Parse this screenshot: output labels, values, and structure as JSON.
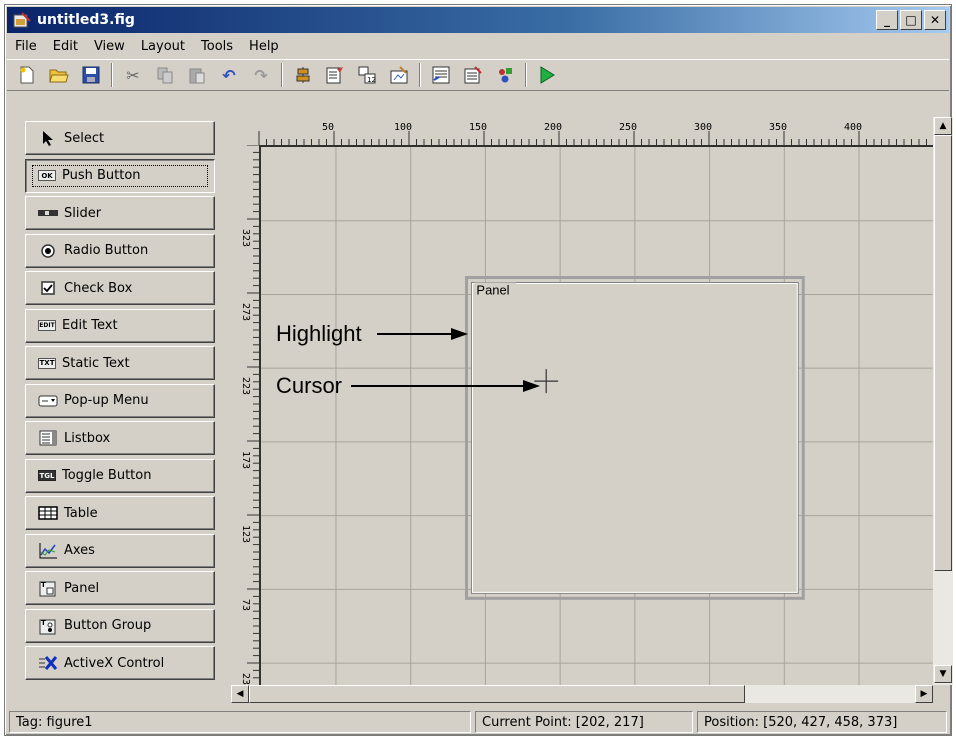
{
  "window": {
    "title": "untitled3.fig"
  },
  "menu": [
    "File",
    "Edit",
    "View",
    "Layout",
    "Tools",
    "Help"
  ],
  "toolbar": {
    "buttons": [
      "new-file-icon",
      "open-folder-icon",
      "save-icon",
      "cut-icon",
      "copy-icon",
      "paste-icon",
      "undo-icon",
      "redo-icon",
      "align-icon",
      "menu-editor-icon",
      "tab-order-icon",
      "toolbar-editor-icon",
      "mfile-editor-icon",
      "property-inspector-icon",
      "object-browser-icon",
      "run-icon"
    ]
  },
  "palette": {
    "items": [
      {
        "label": "Select",
        "icon": "arrow-cursor-icon"
      },
      {
        "label": "Push Button",
        "icon": "push-button-icon",
        "glyph": "OK"
      },
      {
        "label": "Slider",
        "icon": "slider-icon"
      },
      {
        "label": "Radio Button",
        "icon": "radio-button-icon"
      },
      {
        "label": "Check Box",
        "icon": "check-box-icon"
      },
      {
        "label": "Edit Text",
        "icon": "edit-text-icon",
        "glyph": "EDIT"
      },
      {
        "label": "Static Text",
        "icon": "static-text-icon",
        "glyph": "TXT"
      },
      {
        "label": "Pop-up Menu",
        "icon": "popup-menu-icon"
      },
      {
        "label": "Listbox",
        "icon": "listbox-icon"
      },
      {
        "label": "Toggle Button",
        "icon": "toggle-button-icon",
        "glyph": "TGL"
      },
      {
        "label": "Table",
        "icon": "table-icon"
      },
      {
        "label": "Axes",
        "icon": "axes-icon"
      },
      {
        "label": "Panel",
        "icon": "panel-icon"
      },
      {
        "label": "Button Group",
        "icon": "button-group-icon"
      },
      {
        "label": "ActiveX Control",
        "icon": "activex-icon"
      }
    ],
    "selected": "Push Button"
  },
  "rulers": {
    "top_labels": [
      "50",
      "100",
      "150",
      "200",
      "250",
      "300",
      "350",
      "400"
    ],
    "left_labels": [
      "323",
      "273",
      "223",
      "173",
      "123",
      "73",
      "23"
    ]
  },
  "canvas": {
    "panel_title": "Panel",
    "annotations": {
      "highlight": "Highlight",
      "cursor": "Cursor"
    }
  },
  "status": {
    "tag": "Tag: figure1",
    "current_point": "Current Point:  [202, 217]",
    "position": "Position: [520, 427, 458, 373]"
  }
}
